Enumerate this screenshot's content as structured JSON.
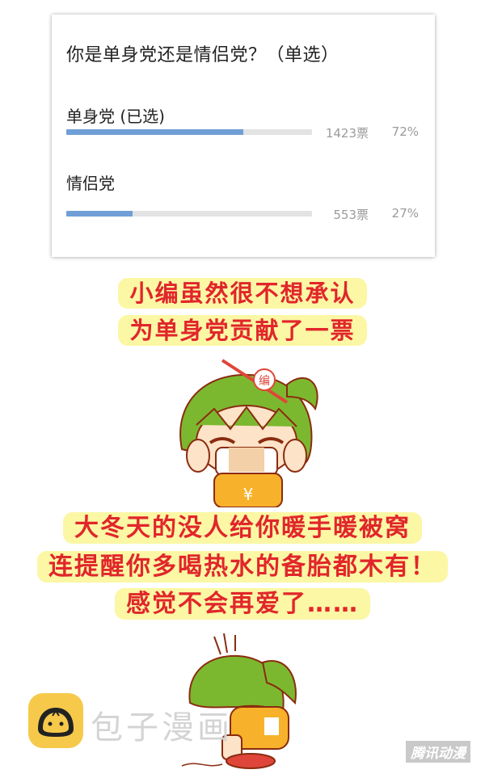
{
  "poll": {
    "question": "你是单身党还是情侣党？（单选）",
    "options": [
      {
        "label": "单身党 (已选)",
        "votes": "1423票",
        "percent": "72%",
        "fill": 0.72
      },
      {
        "label": "情侣党",
        "votes": "553票",
        "percent": "27%",
        "fill": 0.27
      }
    ],
    "bar_color": "#6f9fd6",
    "track_color": "#e3e3e3"
  },
  "captions": {
    "line1": "小编虽然很不想承认",
    "line2": "为单身党贡献了一票",
    "line3": "大冬天的没人给你暖手暖被窝",
    "line4": "连提醒你多喝热水的备胎都木有！",
    "line5": "感觉不会再爱了……",
    "text_color": "#e1262b",
    "highlight_color": "#fbf7a4"
  },
  "watermark": {
    "site_name": "包子漫画",
    "brand": "腾讯动漫",
    "icon": "baozi-icon"
  },
  "characters": {
    "headband_text": "编",
    "shirt_symbol": "¥"
  }
}
